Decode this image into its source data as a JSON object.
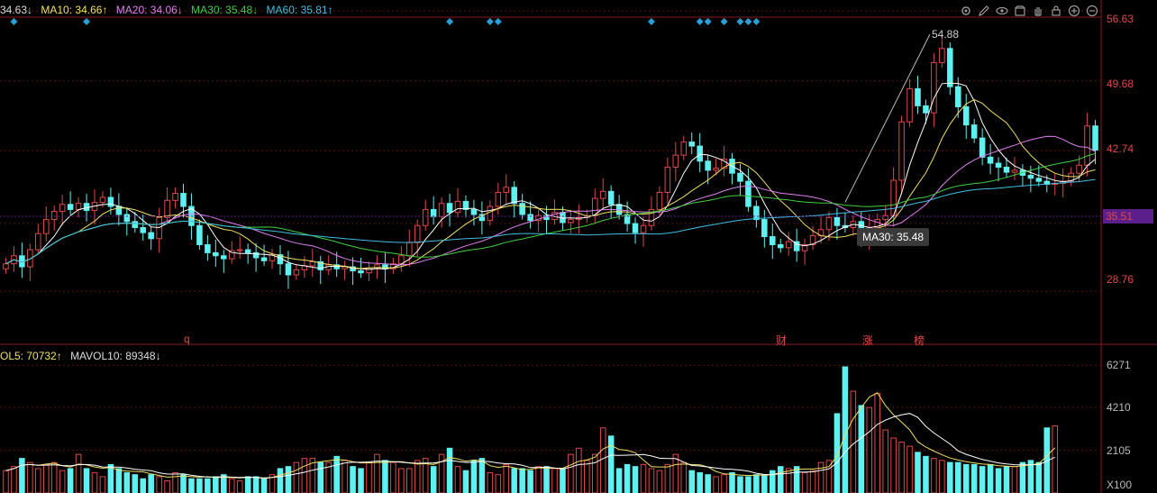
{
  "legend_price": {
    "ma5": "34.63↓",
    "ma10": "MA10: 34.66↑",
    "ma20": "MA20: 34.06↓",
    "ma30": "MA30: 35.48↓",
    "ma60": "MA60: 35.81↑"
  },
  "legend_volume": {
    "vol5": "OL5: 70732↑",
    "vol10": "MAVOL10: 89348↓"
  },
  "tooltip": "MA30: 35.48",
  "current_price_tag": "35.51",
  "peak_label": "54.88",
  "events": [
    "q",
    "财",
    "涨",
    "榜"
  ],
  "colors": {
    "up": "#e04848",
    "down": "#5ff0f0",
    "ma5": "#ffffff",
    "ma10": "#f0e060",
    "ma20": "#e080f0",
    "ma30": "#40d040",
    "ma60": "#40c0e0",
    "grid": "#5a1010",
    "marker": "#2a9fd6"
  },
  "chart_data": {
    "type": "candlestick",
    "price_ticks": [
      "56.63",
      "49.68",
      "42.74",
      "35.51",
      "28.76"
    ],
    "volume_ticks": [
      "6271",
      "4210",
      "2105",
      "X100"
    ],
    "price_range": [
      23.5,
      57.0
    ],
    "volume_range": [
      0,
      6600
    ],
    "price_path": [
      31.5,
      32.3,
      31.2,
      32.9,
      34.5,
      35.9,
      36.7,
      37.4,
      36.9,
      37.5,
      36.8,
      37.6,
      38.1,
      37.2,
      36.4,
      35.7,
      35.1,
      34.6,
      34.0,
      36.1,
      37.8,
      38.5,
      37.2,
      35.3,
      33.4,
      32.6,
      32.3,
      32.0,
      32.8,
      32.9,
      32.6,
      32.1,
      31.8,
      32.4,
      31.5,
      30.4,
      30.9,
      31.3,
      31.7,
      30.9,
      31.4,
      31.0,
      31.2,
      30.8,
      30.6,
      31.1,
      31.4,
      31.0,
      31.5,
      32.3,
      33.6,
      35.3,
      36.9,
      36.2,
      37.5,
      36.6,
      37.7,
      36.9,
      36.4,
      35.8,
      37.2,
      38.6,
      39.1,
      37.5,
      36.4,
      35.8,
      36.3,
      35.9,
      36.6,
      35.6,
      35.9,
      36.1,
      36.3,
      38.0,
      38.7,
      37.4,
      36.4,
      35.5,
      34.6,
      35.3,
      36.9,
      38.6,
      41.1,
      42.3,
      43.6,
      43.2,
      41.7,
      40.8,
      41.0,
      41.9,
      40.5,
      39.7,
      37.2,
      35.9,
      34.2,
      33.4,
      33.1,
      33.7,
      32.8,
      33.4,
      34.3,
      34.9,
      36.1,
      35.3,
      35.1,
      35.7,
      34.3,
      35.1,
      35.9,
      36.3,
      39.8,
      45.6,
      48.9,
      47.2,
      46.5,
      51.5,
      52.9,
      49.1,
      47.1,
      45.3,
      44.0,
      42.1,
      41.5,
      41.1,
      40.6,
      40.8,
      40.3,
      40.0,
      39.7,
      39.4,
      39.5,
      39.7,
      40.5,
      41.3,
      45.2,
      42.8
    ],
    "volume_series": [
      1100,
      1300,
      1700,
      1500,
      1200,
      1400,
      1500,
      1100,
      1200,
      1900,
      1200,
      1000,
      800,
      1400,
      1200,
      1000,
      900,
      700,
      900,
      800,
      600,
      1000,
      900,
      700,
      700,
      700,
      800,
      900,
      700,
      600,
      800,
      800,
      700,
      900,
      1200,
      1300,
      1500,
      1700,
      1700,
      1500,
      1500,
      1800,
      1600,
      1300,
      1200,
      1500,
      1900,
      1600,
      1500,
      1200,
      1200,
      1600,
      1700,
      1300,
      1900,
      2200,
      1300,
      1100,
      1600,
      1700,
      1000,
      900,
      1400,
      1200,
      1200,
      1100,
      1300,
      1300,
      1200,
      1200,
      1900,
      2200,
      1600,
      1900,
      3200,
      2800,
      1200,
      1400,
      1300,
      1400,
      1200,
      1100,
      1400,
      1900,
      1500,
      1100,
      1000,
      900,
      800,
      900,
      1000,
      800,
      800,
      900,
      900,
      1100,
      1300,
      1200,
      1300,
      1000,
      1100,
      1500,
      1600,
      3900,
      6200,
      5000,
      4300,
      4200,
      4900,
      3100,
      2700,
      2500,
      2300,
      2000,
      1800,
      1700,
      1600,
      1500,
      1500,
      1400,
      1400,
      1300,
      1400,
      1200,
      1300,
      1300,
      1500,
      1600,
      1500,
      3200,
      3300
    ],
    "marker_indices": [
      1,
      10,
      55,
      60,
      61,
      80,
      86,
      87,
      89,
      91,
      92,
      93
    ],
    "event_indices": [
      7,
      89,
      99,
      104
    ],
    "peak_index": 104
  }
}
